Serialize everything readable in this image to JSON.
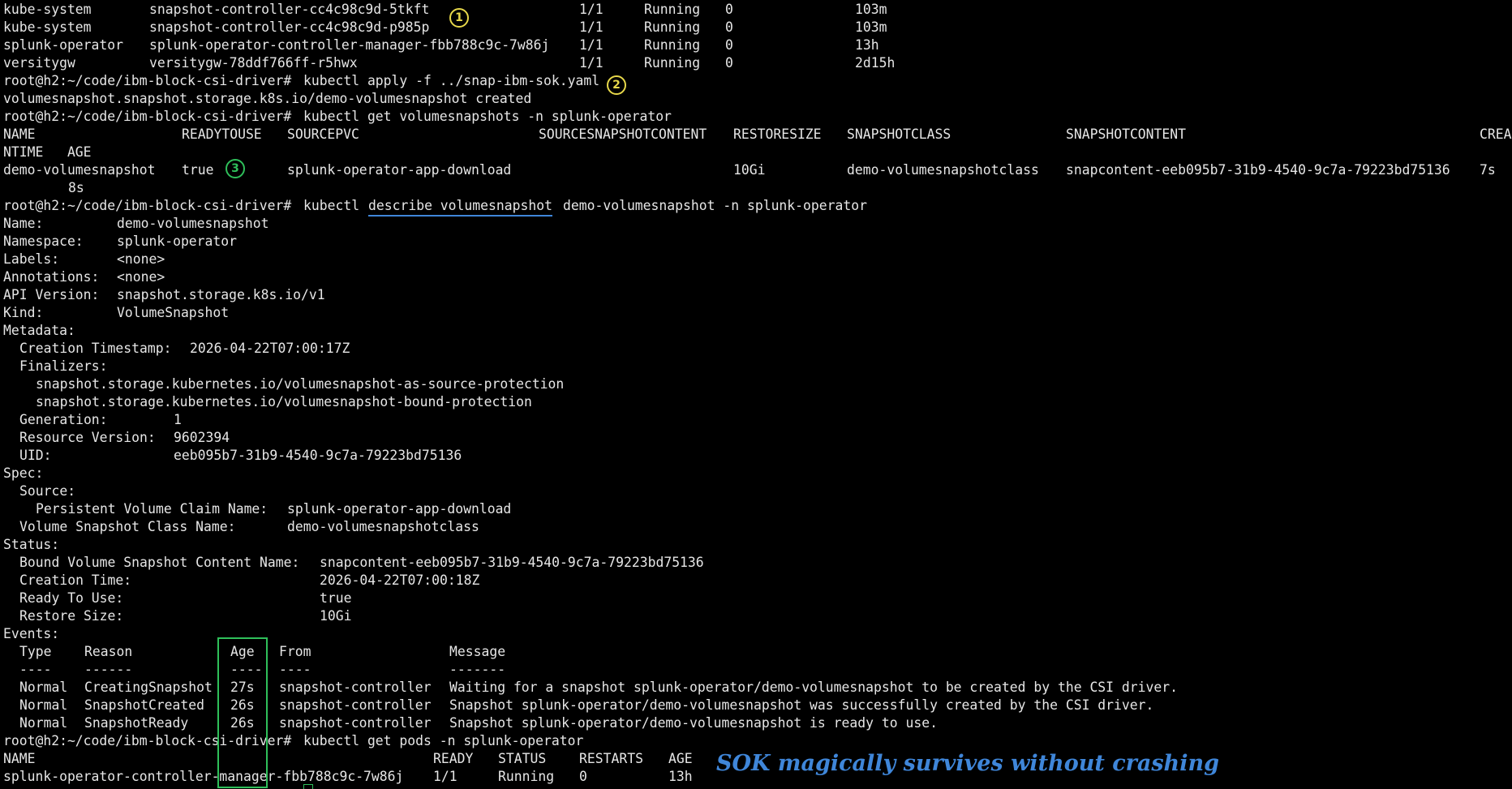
{
  "terminal": {
    "colors": {
      "background": "#000000",
      "text": "#e6e6e6",
      "annotation_yellow": "#e7d84a",
      "annotation_green": "#2fbf5a",
      "annotation_blue": "#3f86d9"
    },
    "pods_top": [
      [
        "kube-system",
        "snapshot-controller-cc4c98c9d-5tkft",
        "1/1",
        "Running",
        "0",
        "103m"
      ],
      [
        "kube-system",
        "snapshot-controller-cc4c98c9d-p985p",
        "1/1",
        "Running",
        "0",
        "103m"
      ],
      [
        "splunk-operator",
        "splunk-operator-controller-manager-fbb788c9c-7w86j",
        "1/1",
        "Running",
        "0",
        "13h"
      ],
      [
        "versitygw",
        "versitygw-78ddf766ff-r5hwx",
        "1/1",
        "Running",
        "0",
        "2d15h"
      ]
    ],
    "prompt": "root@h2:~/code/ibm-block-csi-driver#",
    "cmd_apply": "kubectl apply -f ../snap-ibm-sok.yaml",
    "apply_output": "volumesnapshot.snapshot.storage.k8s.io/demo-volumesnapshot created",
    "cmd_get_snapshots": "kubectl get volumesnapshots -n splunk-operator",
    "snapshot_headers": [
      "NAME",
      "READYTOUSE",
      "SOURCEPVC",
      "SOURCESNAPSHOTCONTENT",
      "RESTORESIZE",
      "SNAPSHOTCLASS",
      "SNAPSHOTCONTENT",
      "CREA"
    ],
    "snapshot_headers_wrap": "NTIME   AGE",
    "snapshot_row": [
      "demo-volumesnapshot",
      "true",
      "splunk-operator-app-download",
      "10Gi",
      "demo-volumesnapshotclass",
      "snapcontent-eeb095b7-31b9-4540-9c7a-79223bd75136",
      "7s"
    ],
    "snapshot_row_wrap": "8s",
    "cmd_describe_pre": "kubectl",
    "cmd_describe_underlined": "describe volumesnapshot",
    "cmd_describe_post": "demo-volumesnapshot -n splunk-operator",
    "describe": [
      {
        "indent": 0,
        "key": "Name:",
        "value": "demo-volumesnapshot"
      },
      {
        "indent": 0,
        "key": "Namespace:",
        "value": "splunk-operator"
      },
      {
        "indent": 0,
        "key": "Labels:",
        "value": "<none>"
      },
      {
        "indent": 0,
        "key": "Annotations:",
        "value": "<none>"
      },
      {
        "indent": 0,
        "key": "API Version:",
        "value": "snapshot.storage.k8s.io/v1"
      },
      {
        "indent": 0,
        "key": "Kind:",
        "value": "VolumeSnapshot"
      },
      {
        "indent": 0,
        "key": "Metadata:",
        "value": ""
      },
      {
        "indent": 1,
        "key": "Creation Timestamp:",
        "value": "2026-04-22T07:00:17Z"
      },
      {
        "indent": 1,
        "key": "Finalizers:",
        "value": ""
      },
      {
        "indent": 2,
        "key": "snapshot.storage.kubernetes.io/volumesnapshot-as-source-protection",
        "value": ""
      },
      {
        "indent": 2,
        "key": "snapshot.storage.kubernetes.io/volumesnapshot-bound-protection",
        "value": ""
      },
      {
        "indent": 1,
        "key": "Generation:",
        "value": "1"
      },
      {
        "indent": 1,
        "key": "Resource Version:",
        "value": "9602394"
      },
      {
        "indent": 1,
        "key": "UID:",
        "value": "eeb095b7-31b9-4540-9c7a-79223bd75136"
      },
      {
        "indent": 0,
        "key": "Spec:",
        "value": ""
      },
      {
        "indent": 1,
        "key": "Source:",
        "value": ""
      },
      {
        "indent": 2,
        "key": "Persistent Volume Claim Name:",
        "value": "splunk-operator-app-download"
      },
      {
        "indent": 1,
        "key": "Volume Snapshot Class Name:",
        "value": "demo-volumesnapshotclass"
      },
      {
        "indent": 0,
        "key": "Status:",
        "value": ""
      },
      {
        "indent": 1,
        "key": "Bound Volume Snapshot Content Name:",
        "value": "snapcontent-eeb095b7-31b9-4540-9c7a-79223bd75136"
      },
      {
        "indent": 1,
        "key": "Creation Time:",
        "value": "2026-04-22T07:00:18Z"
      },
      {
        "indent": 1,
        "key": "Ready To Use:",
        "value": "true"
      },
      {
        "indent": 1,
        "key": "Restore Size:",
        "value": "10Gi"
      },
      {
        "indent": 0,
        "key": "Events:",
        "value": ""
      }
    ],
    "events_headers": [
      "Type",
      "Reason",
      "Age",
      "From",
      "Message"
    ],
    "events_underline": [
      "----",
      "------",
      "----",
      "----",
      "-------"
    ],
    "events": [
      [
        "Normal",
        "CreatingSnapshot",
        "27s",
        "snapshot-controller",
        "Waiting for a snapshot splunk-operator/demo-volumesnapshot to be created by the CSI driver."
      ],
      [
        "Normal",
        "SnapshotCreated",
        "26s",
        "snapshot-controller",
        "Snapshot splunk-operator/demo-volumesnapshot was successfully created by the CSI driver."
      ],
      [
        "Normal",
        "SnapshotReady",
        "26s",
        "snapshot-controller",
        "Snapshot splunk-operator/demo-volumesnapshot is ready to use."
      ]
    ],
    "cmd_get_pods": "kubectl get pods -n splunk-operator",
    "pods_headers": [
      "NAME",
      "READY",
      "STATUS",
      "RESTARTS",
      "AGE"
    ],
    "pods_row": [
      "splunk-operator-controller-manager-fbb788c9c-7w86j",
      "1/1",
      "Running",
      "0",
      "13h"
    ]
  },
  "annotations": {
    "markers": [
      "1",
      "2",
      "3"
    ],
    "caption": "SOK magically survives without crashing"
  }
}
